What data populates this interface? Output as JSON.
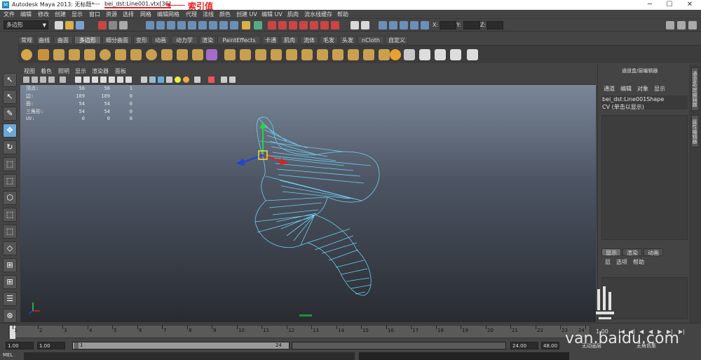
{
  "titlebar": {
    "app_title": "Autodesk Maya 2013: 无标题*",
    "separator": "---",
    "selection_path": "bei_dst:Line001.vtx[36]",
    "annotation": "索引值",
    "minimize": "─",
    "maximize": "☐",
    "close": "✕"
  },
  "menubar": [
    "文件",
    "编辑",
    "修改",
    "创建",
    "显示",
    "窗口",
    "资源",
    "选择",
    "网格",
    "编辑网格",
    "代理",
    "法线",
    "颜色",
    "创建 UV",
    "编辑 UV",
    "肌肉",
    "流水线缓存",
    "帮助"
  ],
  "statusline": {
    "mode": "多边形",
    "x_label": "X:",
    "y_label": "Y:",
    "z_label": "Z:"
  },
  "shelf_tabs": [
    "常规",
    "曲线",
    "曲面",
    "多边形",
    "细分曲面",
    "变形",
    "动画",
    "动力学",
    "渲染",
    "PaintEffects",
    "卡通",
    "肌肉",
    "流体",
    "毛发",
    "头发",
    "nCloth",
    "自定义"
  ],
  "shelf_active_tab": "多边形",
  "viewport": {
    "menus": [
      "视图",
      "着色",
      "照明",
      "显示",
      "渲染器",
      "面板"
    ],
    "hud": [
      {
        "label": "顶点:",
        "a": "56",
        "b": "56",
        "c": "1"
      },
      {
        "label": "边:",
        "a": "109",
        "b": "109",
        "c": "0"
      },
      {
        "label": "面:",
        "a": "54",
        "b": "54",
        "c": "0"
      },
      {
        "label": "三角形:",
        "a": "54",
        "b": "54",
        "c": "0"
      },
      {
        "label": "UV:",
        "a": "0",
        "b": "0",
        "c": "0"
      }
    ]
  },
  "channel_box": {
    "title": "通道盒/层编辑器",
    "menus": [
      "通道",
      "编辑",
      "对象",
      "显示"
    ],
    "object_name": "bei_dst:Line001Shape",
    "cv_text": "CV (单击以显示)"
  },
  "layer_editor": {
    "tabs": [
      "显示",
      "渲染",
      "动画"
    ],
    "menus": [
      "层",
      "选项",
      "帮助"
    ]
  },
  "side_tabs": [
    "通道盒/层编辑器",
    "属性编辑器"
  ],
  "timeline": {
    "ticks": [
      "1",
      "2",
      "3",
      "4",
      "5",
      "6",
      "7",
      "8",
      "9",
      "10",
      "11",
      "12",
      "13",
      "14",
      "15",
      "16",
      "17",
      "18",
      "19",
      "20",
      "21",
      "22",
      "23",
      "24"
    ],
    "current_frame": "1.00"
  },
  "range": {
    "start": "1.00",
    "start2": "1.00",
    "slider_start": "1",
    "slider_end": "24",
    "end": "24.00",
    "end2": "48.00",
    "anim_layer": "无动画层",
    "char_set": "无角色集"
  },
  "mel_label": "MEL",
  "watermark": "van.baidu.com"
}
